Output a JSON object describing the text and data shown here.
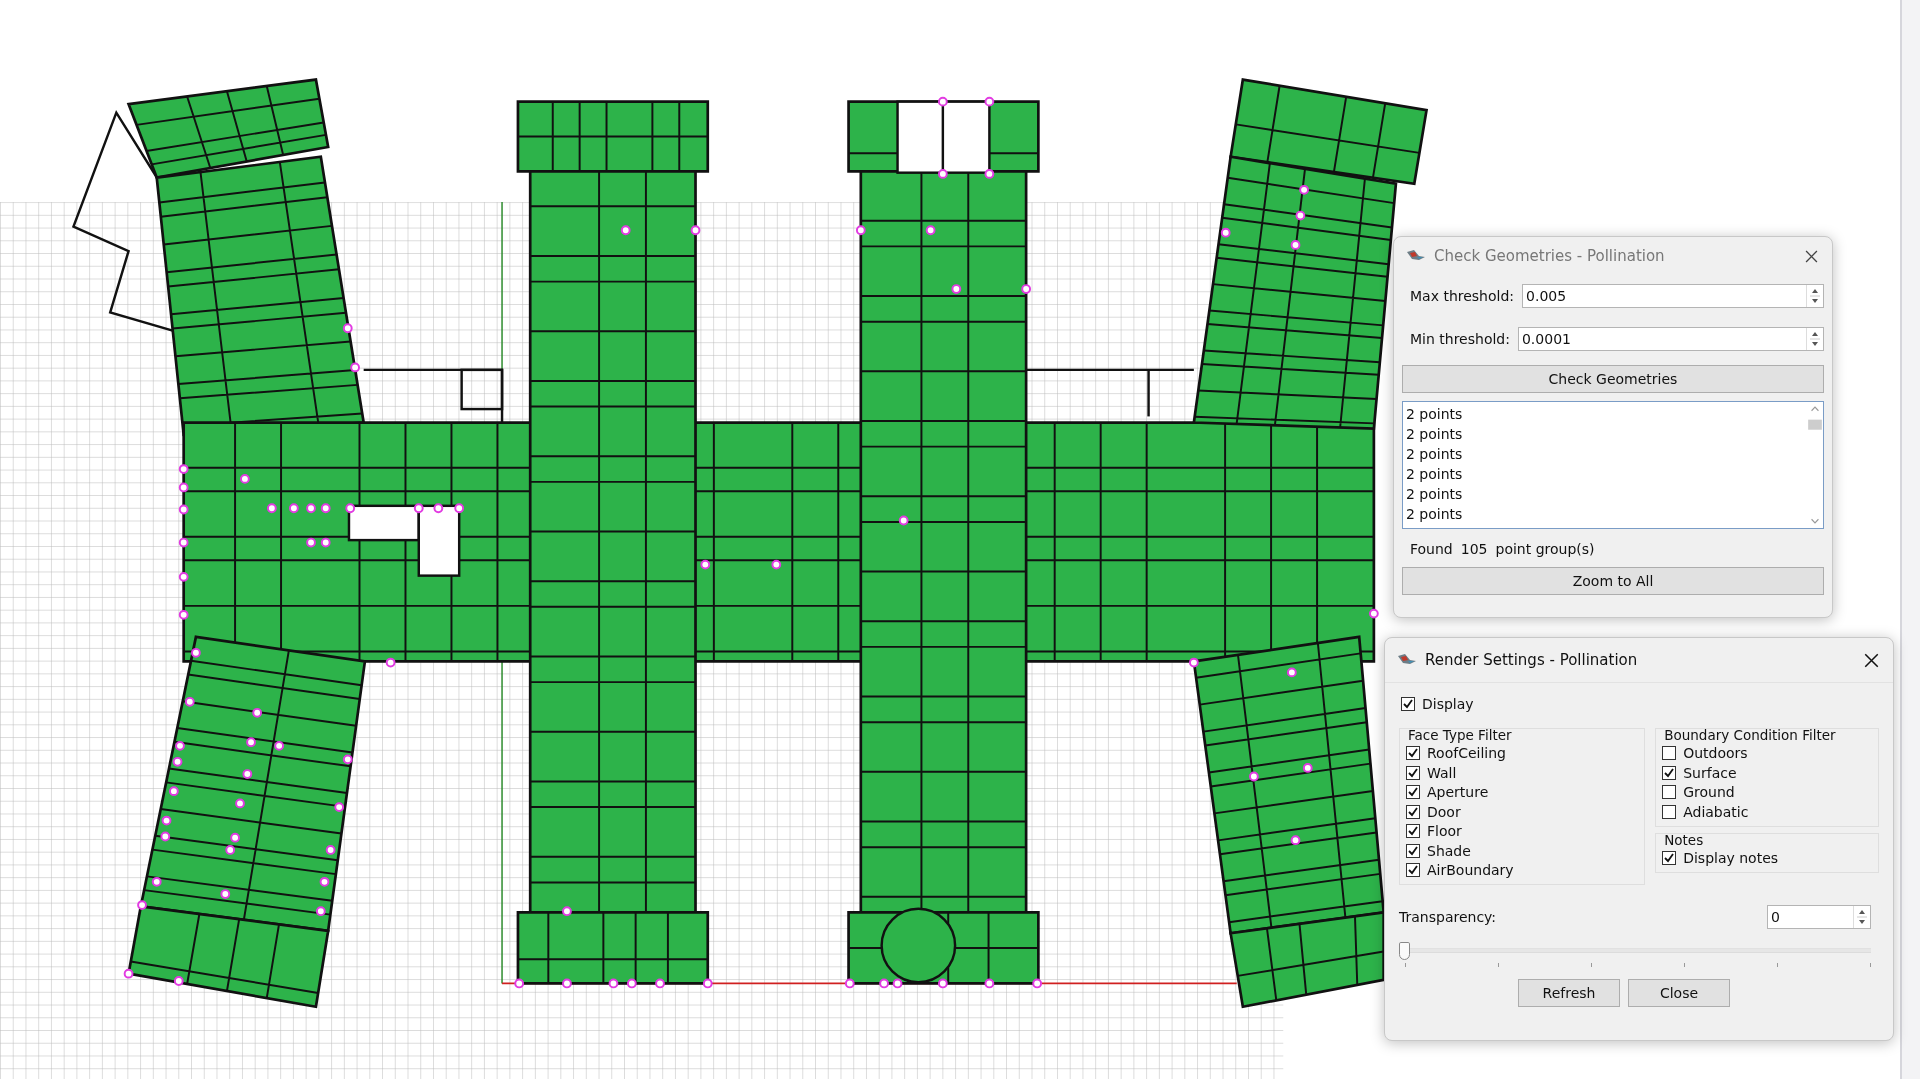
{
  "check_dialog": {
    "title": "Check Geometries - Pollination",
    "fields": [
      {
        "label": "Max threshold:",
        "value": "0.005"
      },
      {
        "label": "Min threshold:",
        "value": "0.0001"
      }
    ],
    "check_button": "Check Geometries",
    "results": [
      "2 points",
      "2 points",
      "2 points",
      "2 points",
      "2 points",
      "2 points"
    ],
    "found": {
      "prefix": "Found",
      "count": "105",
      "suffix": "point group(s)"
    },
    "zoom_button": "Zoom to All"
  },
  "render_dialog": {
    "title": "Render Settings - Pollination",
    "display": {
      "label": "Display",
      "checked": true
    },
    "face_type_filter": {
      "title": "Face Type Filter",
      "items": [
        {
          "label": "RoofCeiling",
          "checked": true
        },
        {
          "label": "Wall",
          "checked": true
        },
        {
          "label": "Aperture",
          "checked": true
        },
        {
          "label": "Door",
          "checked": true
        },
        {
          "label": "Floor",
          "checked": true
        },
        {
          "label": "Shade",
          "checked": true
        },
        {
          "label": "AirBoundary",
          "checked": true
        }
      ]
    },
    "boundary_condition_filter": {
      "title": "Boundary Condition Filter",
      "items": [
        {
          "label": "Outdoors",
          "checked": false
        },
        {
          "label": "Surface",
          "checked": true
        },
        {
          "label": "Ground",
          "checked": false
        },
        {
          "label": "Adiabatic",
          "checked": false
        }
      ]
    },
    "notes": {
      "title": "Notes",
      "items": [
        {
          "label": "Display notes",
          "checked": true
        }
      ]
    },
    "transparency": {
      "label": "Transparency:",
      "value": "0",
      "level": 0
    },
    "buttons": [
      "Refresh",
      "Close"
    ]
  }
}
